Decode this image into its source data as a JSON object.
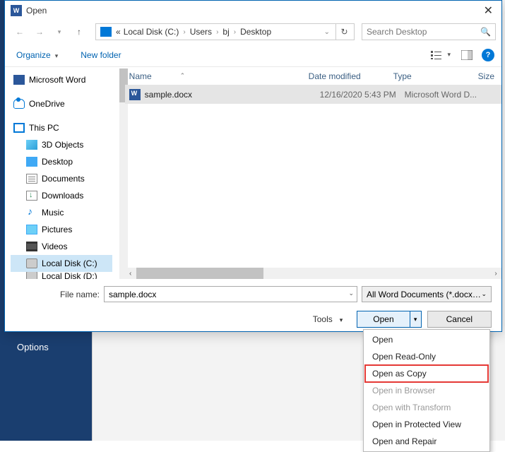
{
  "title": "Open",
  "breadcrumb": {
    "pre": "«",
    "items": [
      "Local Disk (C:)",
      "Users",
      "bj",
      "Desktop"
    ]
  },
  "search": {
    "placeholder": "Search Desktop"
  },
  "toolbar": {
    "organize": "Organize",
    "newfolder": "New folder"
  },
  "tree": {
    "word": "Microsoft Word",
    "onedrive": "OneDrive",
    "thispc": "This PC",
    "obj3d": "3D Objects",
    "desktop": "Desktop",
    "documents": "Documents",
    "downloads": "Downloads",
    "music": "Music",
    "pictures": "Pictures",
    "videos": "Videos",
    "diskc": "Local Disk (C:)",
    "diskd": "Local Disk (D:)"
  },
  "columns": {
    "name": "Name",
    "date": "Date modified",
    "type": "Type",
    "size": "Size"
  },
  "file": {
    "name": "sample.docx",
    "date": "12/16/2020 5:43 PM",
    "type": "Microsoft Word D..."
  },
  "filename": {
    "label": "File name:",
    "value": "sample.docx"
  },
  "filter": "All Word Documents (*.docx;*.d",
  "tools": "Tools",
  "buttons": {
    "open": "Open",
    "cancel": "Cancel"
  },
  "menu": {
    "open": "Open",
    "readonly": "Open Read-Only",
    "copy": "Open as Copy",
    "browser": "Open in Browser",
    "transform": "Open with Transform",
    "protected": "Open in Protected View",
    "repair": "Open and Repair"
  },
  "background": {
    "options": "Options"
  }
}
